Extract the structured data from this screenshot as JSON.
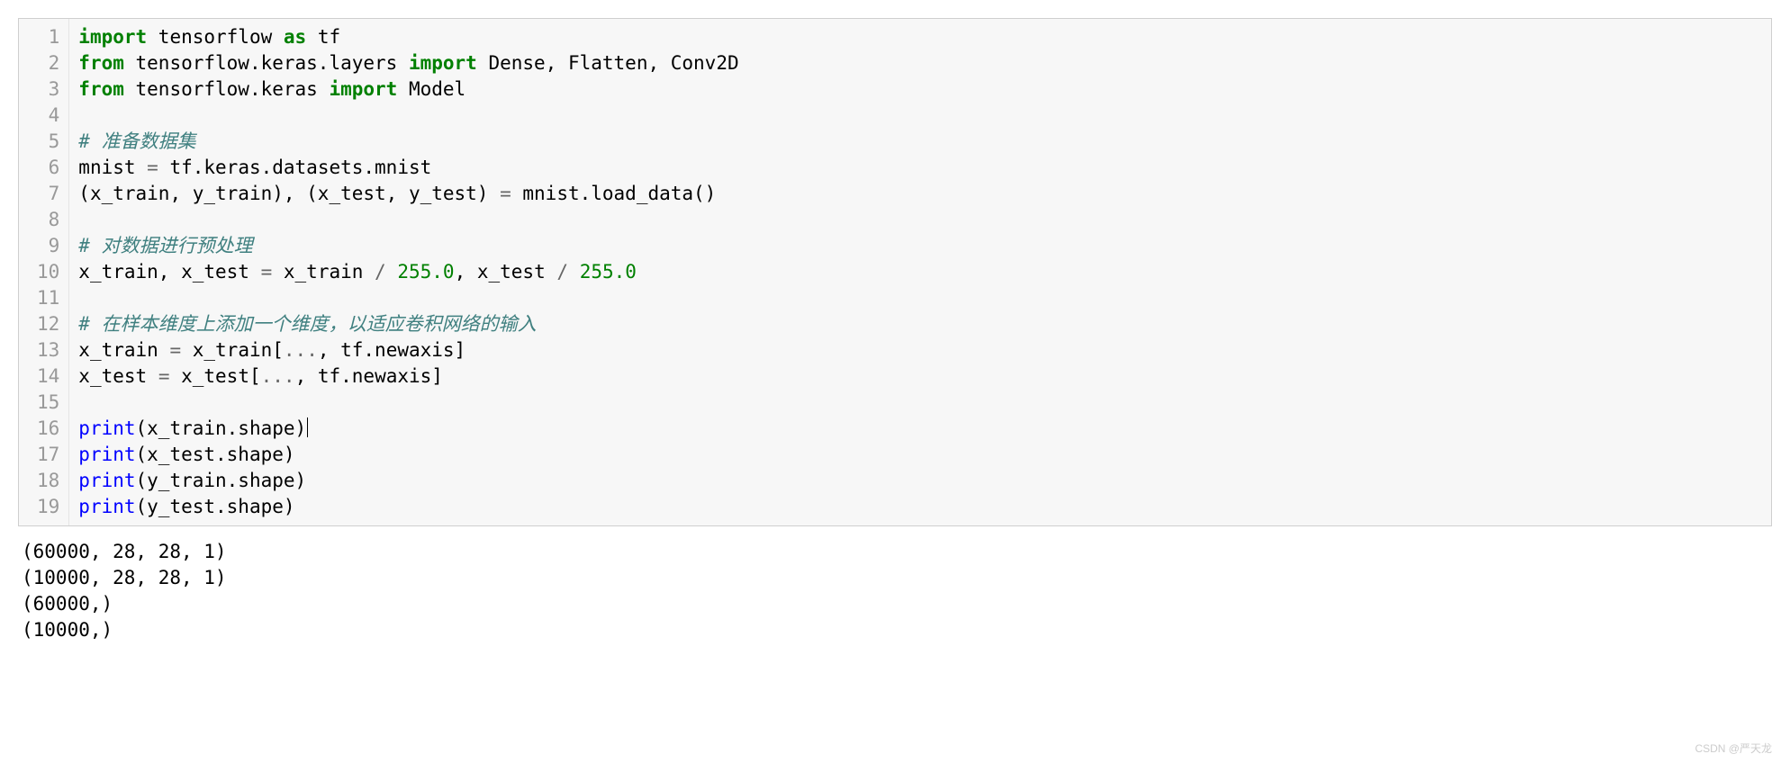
{
  "code": {
    "lines": [
      [
        {
          "cls": "kw",
          "t": "import"
        },
        {
          "cls": "txt",
          "t": " tensorflow "
        },
        {
          "cls": "kw",
          "t": "as"
        },
        {
          "cls": "txt",
          "t": " tf"
        }
      ],
      [
        {
          "cls": "kw",
          "t": "from"
        },
        {
          "cls": "txt",
          "t": " tensorflow.keras.layers "
        },
        {
          "cls": "kw",
          "t": "import"
        },
        {
          "cls": "txt",
          "t": " Dense, Flatten, Conv2D"
        }
      ],
      [
        {
          "cls": "kw",
          "t": "from"
        },
        {
          "cls": "txt",
          "t": " tensorflow.keras "
        },
        {
          "cls": "kw",
          "t": "import"
        },
        {
          "cls": "txt",
          "t": " Model"
        }
      ],
      [],
      [
        {
          "cls": "cm",
          "t": "# 准备数据集"
        }
      ],
      [
        {
          "cls": "txt",
          "t": "mnist "
        },
        {
          "cls": "op",
          "t": "="
        },
        {
          "cls": "txt",
          "t": " tf.keras.datasets.mnist"
        }
      ],
      [
        {
          "cls": "txt",
          "t": "(x_train, y_train), (x_test, y_test) "
        },
        {
          "cls": "op",
          "t": "="
        },
        {
          "cls": "txt",
          "t": " mnist.load_data()"
        }
      ],
      [],
      [
        {
          "cls": "cm",
          "t": "# 对数据进行预处理"
        }
      ],
      [
        {
          "cls": "txt",
          "t": "x_train, x_test "
        },
        {
          "cls": "op",
          "t": "="
        },
        {
          "cls": "txt",
          "t": " x_train "
        },
        {
          "cls": "op",
          "t": "/"
        },
        {
          "cls": "txt",
          "t": " "
        },
        {
          "cls": "num",
          "t": "255.0"
        },
        {
          "cls": "txt",
          "t": ", x_test "
        },
        {
          "cls": "op",
          "t": "/"
        },
        {
          "cls": "txt",
          "t": " "
        },
        {
          "cls": "num",
          "t": "255.0"
        }
      ],
      [],
      [
        {
          "cls": "cm",
          "t": "# 在样本维度上添加一个维度，以适应卷积网络的输入"
        }
      ],
      [
        {
          "cls": "txt",
          "t": "x_train "
        },
        {
          "cls": "op",
          "t": "="
        },
        {
          "cls": "txt",
          "t": " x_train["
        },
        {
          "cls": "op",
          "t": "..."
        },
        {
          "cls": "txt",
          "t": ", tf.newaxis]"
        }
      ],
      [
        {
          "cls": "txt",
          "t": "x_test "
        },
        {
          "cls": "op",
          "t": "="
        },
        {
          "cls": "txt",
          "t": " x_test["
        },
        {
          "cls": "op",
          "t": "..."
        },
        {
          "cls": "txt",
          "t": ", tf.newaxis]"
        }
      ],
      [],
      [
        {
          "cls": "fn",
          "t": "print"
        },
        {
          "cls": "txt",
          "t": "(x_train.shape)"
        },
        {
          "cls": "cursor",
          "t": ""
        }
      ],
      [
        {
          "cls": "fn",
          "t": "print"
        },
        {
          "cls": "txt",
          "t": "(x_test.shape)"
        }
      ],
      [
        {
          "cls": "fn",
          "t": "print"
        },
        {
          "cls": "txt",
          "t": "(y_train.shape)"
        }
      ],
      [
        {
          "cls": "fn",
          "t": "print"
        },
        {
          "cls": "txt",
          "t": "(y_test.shape)"
        }
      ]
    ]
  },
  "output": {
    "lines": [
      "(60000, 28, 28, 1)",
      "(10000, 28, 28, 1)",
      "(60000,)",
      "(10000,)"
    ]
  },
  "watermark": "CSDN @严天龙"
}
